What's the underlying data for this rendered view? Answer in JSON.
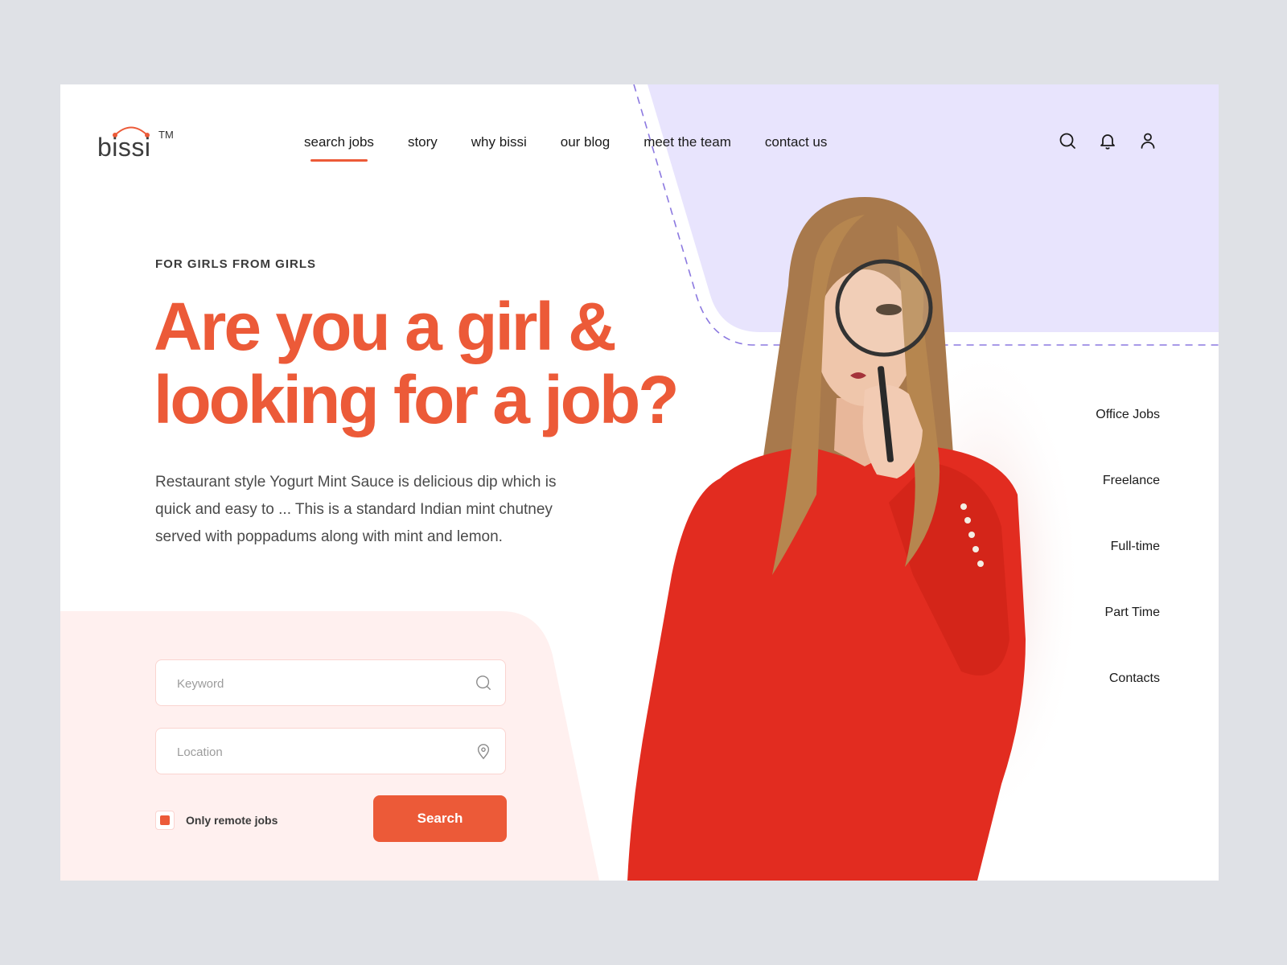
{
  "brand": {
    "name": "bissi",
    "trademark": "TM",
    "accent_color": "#ec5a38",
    "lavender_color": "#e8e4fd",
    "blush_color": "#fff0ef"
  },
  "nav": {
    "items": [
      {
        "label": "search jobs",
        "active": true
      },
      {
        "label": "story",
        "active": false
      },
      {
        "label": "why bissi",
        "active": false
      },
      {
        "label": "our blog",
        "active": false
      },
      {
        "label": "meet the team",
        "active": false
      },
      {
        "label": "contact us",
        "active": false
      }
    ]
  },
  "header_icons": [
    "search-icon",
    "bell-icon",
    "user-icon"
  ],
  "hero": {
    "eyebrow": "FOR GIRLS FROM GIRLS",
    "headline_line1": "Are you a girl &",
    "headline_line2": "looking for a job?",
    "description": "Restaurant style Yogurt Mint Sauce is delicious dip which is quick and easy to ... This is a standard Indian mint chutney served with poppadums along with mint and lemon."
  },
  "search_form": {
    "keyword_placeholder": "Keyword",
    "keyword_value": "",
    "location_placeholder": "Location",
    "location_value": "",
    "remote_label": "Only remote jobs",
    "remote_checked": true,
    "search_label": "Search"
  },
  "side_menu": {
    "items": [
      "Office Jobs",
      "Freelance",
      "Full-time",
      "Part Time",
      "Contacts"
    ]
  },
  "hero_image": {
    "description": "woman in red sweater holding a magnifying glass over her eye"
  }
}
